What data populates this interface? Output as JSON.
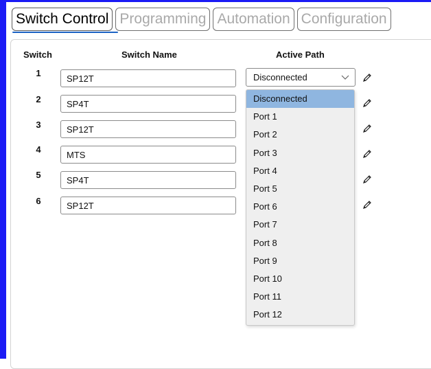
{
  "tabs": [
    {
      "label": "Switch Control",
      "active": true
    },
    {
      "label": "Programming",
      "active": false
    },
    {
      "label": "Automation",
      "active": false
    },
    {
      "label": "Configuration",
      "active": false
    }
  ],
  "table": {
    "headers": {
      "switch": "Switch",
      "name": "Switch Name",
      "path": "Active Path"
    },
    "rows": [
      {
        "num": "1",
        "name": "SP12T"
      },
      {
        "num": "2",
        "name": "SP4T"
      },
      {
        "num": "3",
        "name": "SP12T"
      },
      {
        "num": "4",
        "name": "MTS"
      },
      {
        "num": "5",
        "name": "SP4T"
      },
      {
        "num": "6",
        "name": "SP12T"
      }
    ]
  },
  "active_path_select": {
    "value": "Disconnected",
    "options": [
      "Disconnected",
      "Port 1",
      "Port 2",
      "Port 3",
      "Port 4",
      "Port 5",
      "Port 6",
      "Port 7",
      "Port 8",
      "Port 9",
      "Port 10",
      "Port 11",
      "Port 12"
    ],
    "highlighted_index": 0
  },
  "colors": {
    "frame": "#1b1bf5",
    "accent_underline": "#1c63c4",
    "option_highlight": "#8fb6e0"
  },
  "icons": {
    "edit": "pencil-icon",
    "dropdown": "chevron-down-icon"
  }
}
